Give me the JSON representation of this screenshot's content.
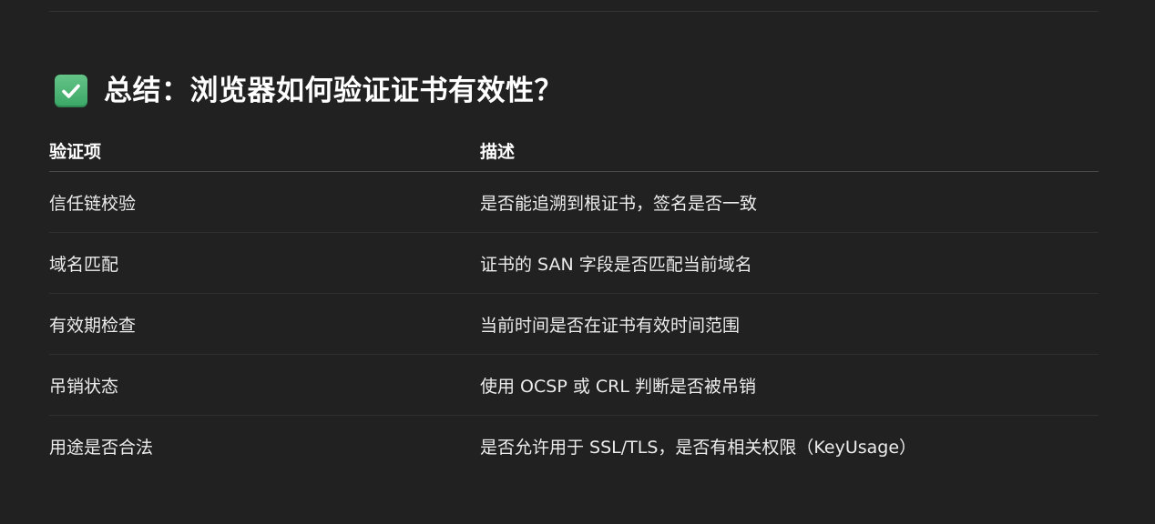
{
  "section": {
    "icon": "check-mark-button-icon",
    "icon_color": "#4cb877",
    "title": "总结：浏览器如何验证证书有效性？"
  },
  "table": {
    "headers": [
      "验证项",
      "描述"
    ],
    "rows": [
      [
        "信任链校验",
        "是否能追溯到根证书，签名是否一致"
      ],
      [
        "域名匹配",
        "证书的 SAN 字段是否匹配当前域名"
      ],
      [
        "有效期检查",
        "当前时间是否在证书有效时间范围"
      ],
      [
        "吊销状态",
        "使用 OCSP 或 CRL 判断是否被吊销"
      ],
      [
        "用途是否合法",
        "是否允许用于 SSL/TLS，是否有相关权限（KeyUsage）"
      ]
    ]
  },
  "colors": {
    "background": "#212121",
    "text": "#ececec",
    "heading": "#ffffff"
  }
}
